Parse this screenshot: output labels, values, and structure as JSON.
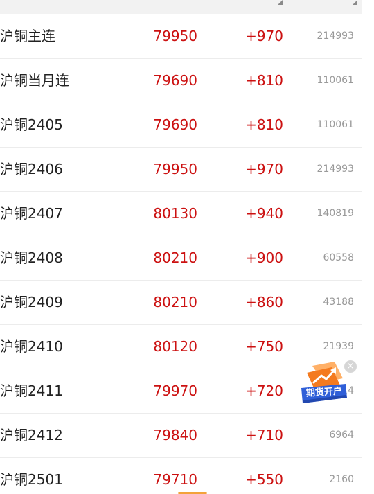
{
  "quotes": {
    "rows": [
      {
        "name": "沪铜主连",
        "price": "79950",
        "change": "+970",
        "volume": "214993"
      },
      {
        "name": "沪铜当月连",
        "price": "79690",
        "change": "+810",
        "volume": "110061"
      },
      {
        "name": "沪铜2405",
        "price": "79690",
        "change": "+810",
        "volume": "110061"
      },
      {
        "name": "沪铜2406",
        "price": "79950",
        "change": "+970",
        "volume": "214993"
      },
      {
        "name": "沪铜2407",
        "price": "80130",
        "change": "+940",
        "volume": "140819"
      },
      {
        "name": "沪铜2408",
        "price": "80210",
        "change": "+900",
        "volume": "60558"
      },
      {
        "name": "沪铜2409",
        "price": "80210",
        "change": "+860",
        "volume": "43188"
      },
      {
        "name": "沪铜2410",
        "price": "80120",
        "change": "+750",
        "volume": "21939"
      },
      {
        "name": "沪铜2411",
        "price": "79970",
        "change": "+720",
        "volume": "7614"
      },
      {
        "name": "沪铜2412",
        "price": "79840",
        "change": "+710",
        "volume": "6964"
      },
      {
        "name": "沪铜2501",
        "price": "79710",
        "change": "+550",
        "volume": "2160"
      }
    ]
  },
  "promo": {
    "label": "期货开户",
    "icon": "trend-arrow-icon",
    "close_icon": "close-icon"
  },
  "colors": {
    "up": "#cc1111",
    "name_text": "#222222",
    "volume_text": "#999999",
    "promo_orange": "#f47a1f",
    "promo_blue": "#2f5fd8"
  }
}
